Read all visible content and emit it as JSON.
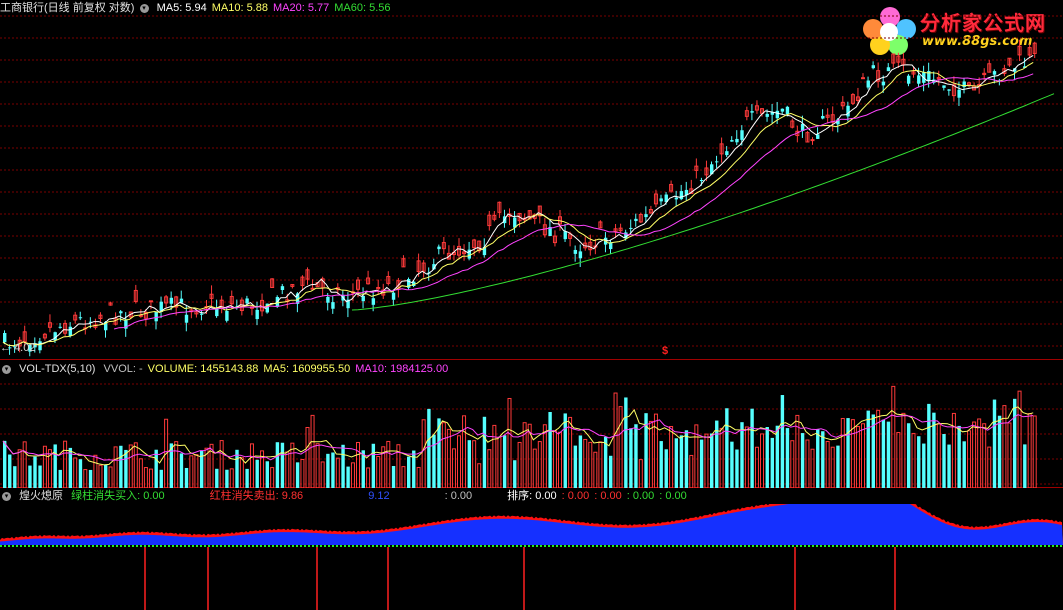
{
  "main_panel": {
    "title": "工商银行(日线 前复权 对数)",
    "ma_labels": [
      {
        "text": "MA5: 5.94",
        "color": "#ffffff"
      },
      {
        "text": "MA10: 5.88",
        "color": "#ffff66"
      },
      {
        "text": "MA20: 5.77",
        "color": "#ff44ff"
      },
      {
        "text": "MA60: 5.56",
        "color": "#33dd33"
      }
    ],
    "low_marker": "4.02",
    "event_marker": "$"
  },
  "volume_panel": {
    "title": "VOL-TDX(5,10)",
    "labels": [
      {
        "text": "VVOL: -",
        "color": "#c0c0c0"
      },
      {
        "text": "VOLUME: 1455143.88",
        "color": "#ffff66"
      },
      {
        "text": "MA5: 1609955.50",
        "color": "#ffff66"
      },
      {
        "text": "MA10: 1984125.00",
        "color": "#ff44ff"
      }
    ]
  },
  "indicator_panel": {
    "title": "煌火熄原",
    "labels": [
      {
        "text": "绿柱消失买入: 0.00",
        "color": "#33dd33"
      },
      {
        "text": "红柱消失卖出: 9.86",
        "color": "#ff3030"
      },
      {
        "text": "9.12",
        "color": "#3050ff"
      },
      {
        "text": ": 0.00",
        "color": "#c0c0c0"
      },
      {
        "text": "排序: 0.00",
        "color": "#ffffff"
      },
      {
        "text": ": 0.00",
        "color": "#ff3030"
      },
      {
        "text": ": 0.00",
        "color": "#ff3030"
      },
      {
        "text": ": 0.00",
        "color": "#33dd33"
      },
      {
        "text": ": 0.00",
        "color": "#33dd33"
      }
    ]
  },
  "watermark": {
    "name": "分析家公式网",
    "url": "www.88gs.com"
  },
  "colors": {
    "up": "#ff3a3a",
    "down": "#55ffff",
    "grid": "#7a0000",
    "ma5": "#ffffff",
    "ma10": "#ffff66",
    "ma20": "#ff44ff",
    "ma60": "#33dd33",
    "area_blue": "#1530ff",
    "area_red": "#ff1010",
    "dotline": "#22ee22"
  }
}
